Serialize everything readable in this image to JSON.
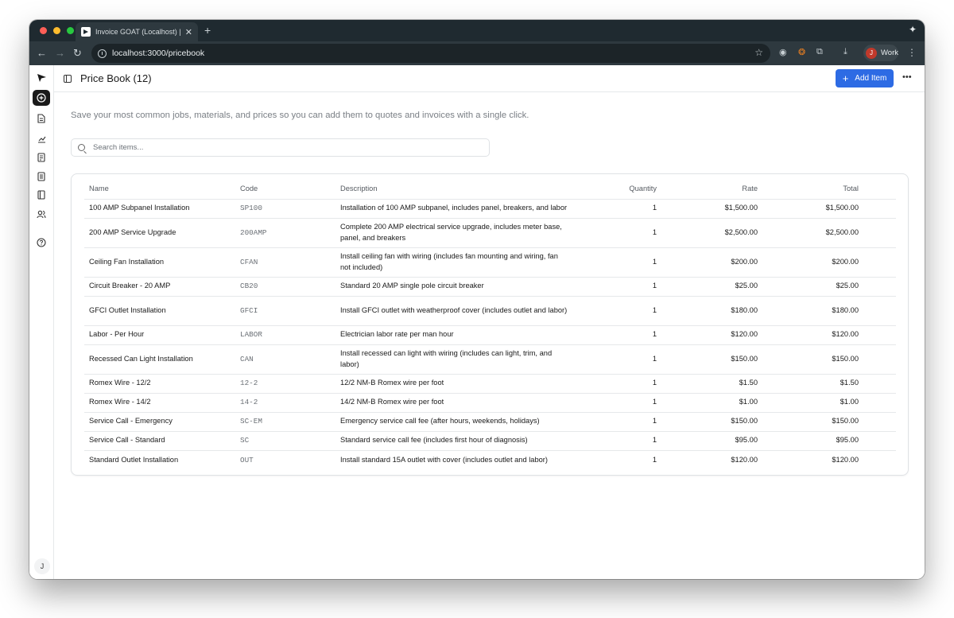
{
  "browser": {
    "tab_title": "Invoice GOAT (Localhost) | W",
    "url": "localhost:3000/pricebook",
    "profile_label": "Work",
    "profile_initial": "J",
    "colors": {
      "close": "#ff5f57",
      "minimize": "#febc2e",
      "maximize": "#28c840"
    }
  },
  "app": {
    "page_title": "Price Book (12)",
    "add_button_label": "Add Item",
    "intro_text": "Save your most common jobs, materials, and prices so you can add them to quotes and invoices with a single click.",
    "search_placeholder": "Search items...",
    "user_initial": "J",
    "accent_color": "#2d6be4"
  },
  "sidebar": {
    "items": [
      {
        "name": "home-icon"
      },
      {
        "name": "new-icon",
        "active": true
      },
      {
        "name": "document-icon"
      },
      {
        "name": "chart-icon"
      },
      {
        "name": "invoice-icon"
      },
      {
        "name": "receipt-icon"
      },
      {
        "name": "book-icon"
      },
      {
        "name": "users-icon"
      },
      {
        "name": "help-icon"
      }
    ]
  },
  "table": {
    "headers": {
      "name": "Name",
      "code": "Code",
      "description": "Description",
      "quantity": "Quantity",
      "rate": "Rate",
      "total": "Total"
    },
    "rows": [
      {
        "name": "100 AMP Subpanel Installation",
        "code": "SP100",
        "description": "Installation of 100 AMP subpanel, includes panel, breakers, and labor",
        "quantity": "1",
        "rate": "$1,500.00",
        "total": "$1,500.00"
      },
      {
        "name": "200 AMP Service Upgrade",
        "code": "200AMP",
        "description": "Complete 200 AMP electrical service upgrade, includes meter base, panel, and breakers",
        "quantity": "1",
        "rate": "$2,500.00",
        "total": "$2,500.00"
      },
      {
        "name": "Ceiling Fan Installation",
        "code": "CFAN",
        "description": "Install ceiling fan with wiring (includes fan mounting and wiring, fan not included)",
        "quantity": "1",
        "rate": "$200.00",
        "total": "$200.00"
      },
      {
        "name": "Circuit Breaker - 20 AMP",
        "code": "CB20",
        "description": "Standard 20 AMP single pole circuit breaker",
        "quantity": "1",
        "rate": "$25.00",
        "total": "$25.00"
      },
      {
        "name": "GFCI Outlet Installation",
        "code": "GFCI",
        "description": "Install GFCI outlet with weatherproof cover (includes outlet and labor)",
        "quantity": "1",
        "rate": "$180.00",
        "total": "$180.00"
      },
      {
        "name": "Labor - Per Hour",
        "code": "LABOR",
        "description": "Electrician labor rate per man hour",
        "quantity": "1",
        "rate": "$120.00",
        "total": "$120.00"
      },
      {
        "name": "Recessed Can Light Installation",
        "code": "CAN",
        "description": "Install recessed can light with wiring (includes can light, trim, and labor)",
        "quantity": "1",
        "rate": "$150.00",
        "total": "$150.00"
      },
      {
        "name": "Romex Wire - 12/2",
        "code": "12-2",
        "description": "12/2 NM-B Romex wire per foot",
        "quantity": "1",
        "rate": "$1.50",
        "total": "$1.50"
      },
      {
        "name": "Romex Wire - 14/2",
        "code": "14-2",
        "description": "14/2 NM-B Romex wire per foot",
        "quantity": "1",
        "rate": "$1.00",
        "total": "$1.00"
      },
      {
        "name": "Service Call - Emergency",
        "code": "SC-EM",
        "description": "Emergency service call fee (after hours, weekends, holidays)",
        "quantity": "1",
        "rate": "$150.00",
        "total": "$150.00"
      },
      {
        "name": "Service Call - Standard",
        "code": "SC",
        "description": "Standard service call fee (includes first hour of diagnosis)",
        "quantity": "1",
        "rate": "$95.00",
        "total": "$95.00"
      },
      {
        "name": "Standard Outlet Installation",
        "code": "OUT",
        "description": "Install standard 15A outlet with cover (includes outlet and labor)",
        "quantity": "1",
        "rate": "$120.00",
        "total": "$120.00"
      }
    ]
  }
}
